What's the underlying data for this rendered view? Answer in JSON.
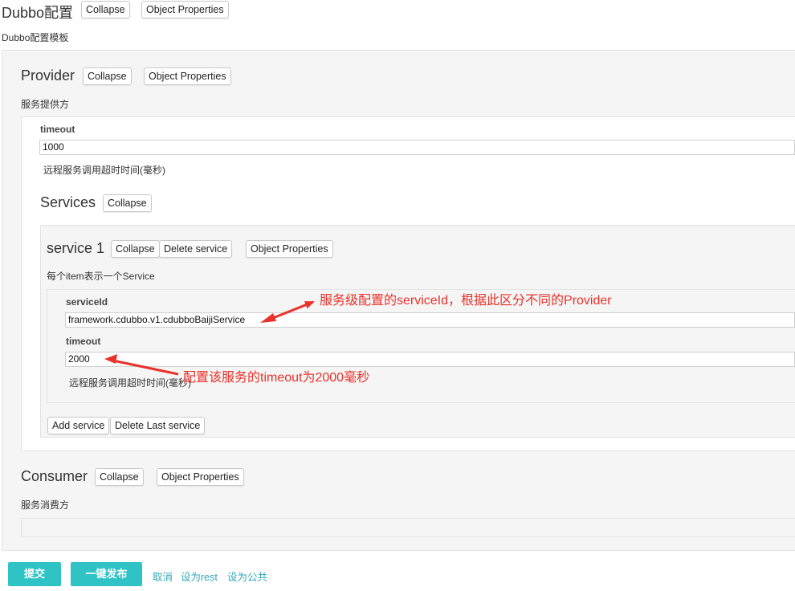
{
  "root": {
    "title": "Dubbo配置",
    "description": "Dubbo配置模板",
    "collapse": "Collapse",
    "object_properties": "Object Properties"
  },
  "provider": {
    "title": "Provider",
    "description": "服务提供方",
    "collapse": "Collapse",
    "object_properties": "Object Properties",
    "timeout_label": "timeout",
    "timeout_value": "1000",
    "timeout_desc": "远程服务调用超时时间(毫秒)"
  },
  "services": {
    "title": "Services",
    "collapse": "Collapse",
    "item": {
      "title": "service 1",
      "collapse": "Collapse",
      "delete": "Delete service",
      "object_properties": "Object Properties",
      "description": "每个item表示一个Service",
      "serviceid_label": "serviceId",
      "serviceid_value": "framework.cdubbo.v1.cdubboBaijiService",
      "timeout_label": "timeout",
      "timeout_value": "2000",
      "timeout_desc": "远程服务调用超时时间(毫秒)"
    },
    "add": "Add service",
    "delete_last": "Delete Last service"
  },
  "consumer": {
    "title": "Consumer",
    "collapse": "Collapse",
    "object_properties": "Object Properties",
    "description": "服务消费方"
  },
  "annotations": {
    "serviceid_note": "服务级配置的serviceId，根据此区分不同的Provider",
    "timeout_note": "配置该服务的timeout为2000毫秒"
  },
  "footer": {
    "submit": "提交",
    "publish": "一键发布",
    "cancel": "取消",
    "set_rest": "设为rest",
    "set_public": "设为公共"
  },
  "colors": {
    "accent": "#2fc3c5",
    "annotation": "#e8322a",
    "link": "#2fa8b8"
  }
}
